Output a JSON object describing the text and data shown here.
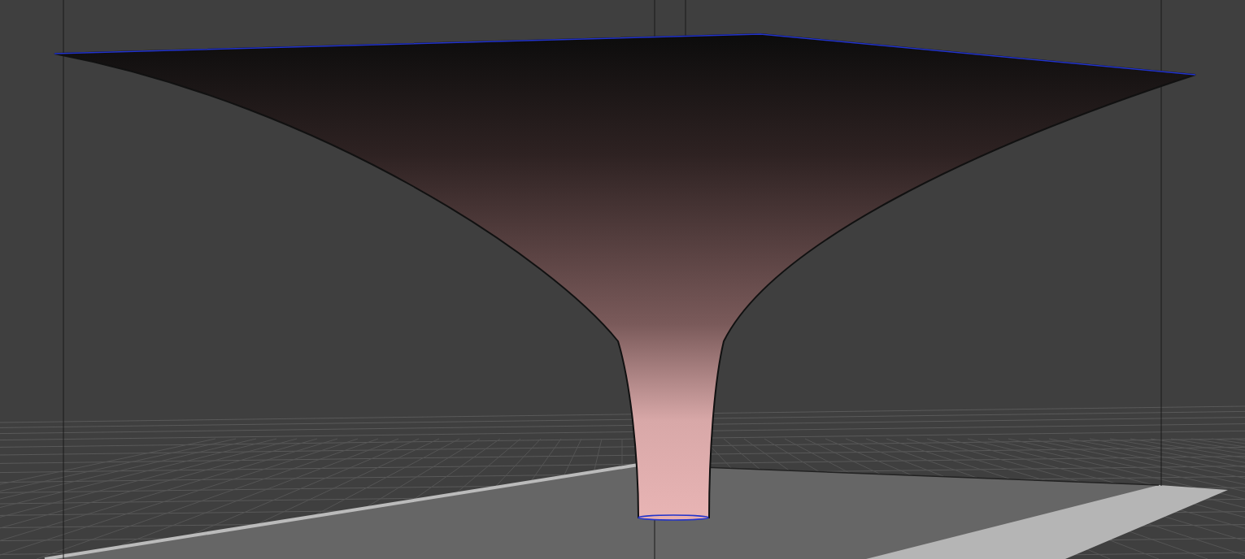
{
  "viewport": {
    "kind": "scene",
    "model": {
      "kind": "funnel"
    },
    "bed": {
      "kind": "plate"
    }
  }
}
